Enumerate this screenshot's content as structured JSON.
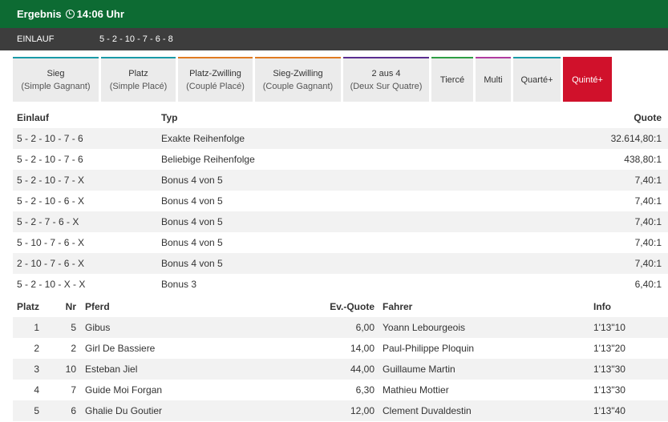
{
  "header": {
    "title": "Ergebnis",
    "time": "14:06 Uhr"
  },
  "einlauf": {
    "label": "EINLAUF",
    "value": "5 - 2 - 10 - 7 - 6 - 8"
  },
  "tabs": [
    {
      "label": "Sieg",
      "sub": "(Simple Gagnant)",
      "color": "#1a9aa8",
      "active": false
    },
    {
      "label": "Platz",
      "sub": "(Simple Placé)",
      "color": "#1a9aa8",
      "active": false
    },
    {
      "label": "Platz-Zwilling",
      "sub": "(Couplé Placé)",
      "color": "#e07b22",
      "active": false
    },
    {
      "label": "Sieg-Zwilling",
      "sub": "(Couple Gagnant)",
      "color": "#e07b22",
      "active": false
    },
    {
      "label": "2 aus 4",
      "sub": "(Deux Sur Quatre)",
      "color": "#5b2d90",
      "active": false
    },
    {
      "label": "Tiercé",
      "sub": "",
      "color": "#2e9e44",
      "active": false
    },
    {
      "label": "Multi",
      "sub": "",
      "color": "#b03ba0",
      "active": false
    },
    {
      "label": "Quarté+",
      "sub": "",
      "color": "#1a9aa8",
      "active": false
    },
    {
      "label": "Quinté+",
      "sub": "",
      "color": "#d0112b",
      "active": true
    }
  ],
  "quoten": {
    "headers": {
      "einlauf": "Einlauf",
      "typ": "Typ",
      "quote": "Quote"
    },
    "rows": [
      {
        "einlauf": "5 - 2 - 10 - 7 - 6",
        "typ": "Exakte Reihenfolge",
        "quote": "32.614,80:1"
      },
      {
        "einlauf": "5 - 2 - 10 - 7 - 6",
        "typ": "Beliebige Reihenfolge",
        "quote": "438,80:1"
      },
      {
        "einlauf": "5 - 2 - 10 - 7 - X",
        "typ": "Bonus 4 von 5",
        "quote": "7,40:1"
      },
      {
        "einlauf": "5 - 2 - 10 - 6 - X",
        "typ": "Bonus 4 von 5",
        "quote": "7,40:1"
      },
      {
        "einlauf": "5 - 2 - 7 - 6 - X",
        "typ": "Bonus 4 von 5",
        "quote": "7,40:1"
      },
      {
        "einlauf": "5 - 10 - 7 - 6 - X",
        "typ": "Bonus 4 von 5",
        "quote": "7,40:1"
      },
      {
        "einlauf": "2 - 10 - 7 - 6 - X",
        "typ": "Bonus 4 von 5",
        "quote": "7,40:1"
      },
      {
        "einlauf": "5 - 2 - 10 - X - X",
        "typ": "Bonus 3",
        "quote": "6,40:1"
      }
    ]
  },
  "ergebnis": {
    "headers": {
      "platz": "Platz",
      "nr": "Nr",
      "pferd": "Pferd",
      "quote": "Ev.-Quote",
      "fahrer": "Fahrer",
      "info": "Info"
    },
    "rows": [
      {
        "platz": "1",
        "nr": "5",
        "pferd": "Gibus",
        "quote": "6,00",
        "fahrer": "Yoann Lebourgeois",
        "info": "1'13\"10"
      },
      {
        "platz": "2",
        "nr": "2",
        "pferd": "Girl De Bassiere",
        "quote": "14,00",
        "fahrer": "Paul-Philippe Ploquin",
        "info": "1'13\"20"
      },
      {
        "platz": "3",
        "nr": "10",
        "pferd": "Esteban Jiel",
        "quote": "44,00",
        "fahrer": "Guillaume Martin",
        "info": "1'13\"30"
      },
      {
        "platz": "4",
        "nr": "7",
        "pferd": "Guide Moi Forgan",
        "quote": "6,30",
        "fahrer": "Mathieu Mottier",
        "info": "1'13\"30"
      },
      {
        "platz": "5",
        "nr": "6",
        "pferd": "Ghalie Du Goutier",
        "quote": "12,00",
        "fahrer": "Clement Duvaldestin",
        "info": "1'13\"40"
      }
    ]
  }
}
